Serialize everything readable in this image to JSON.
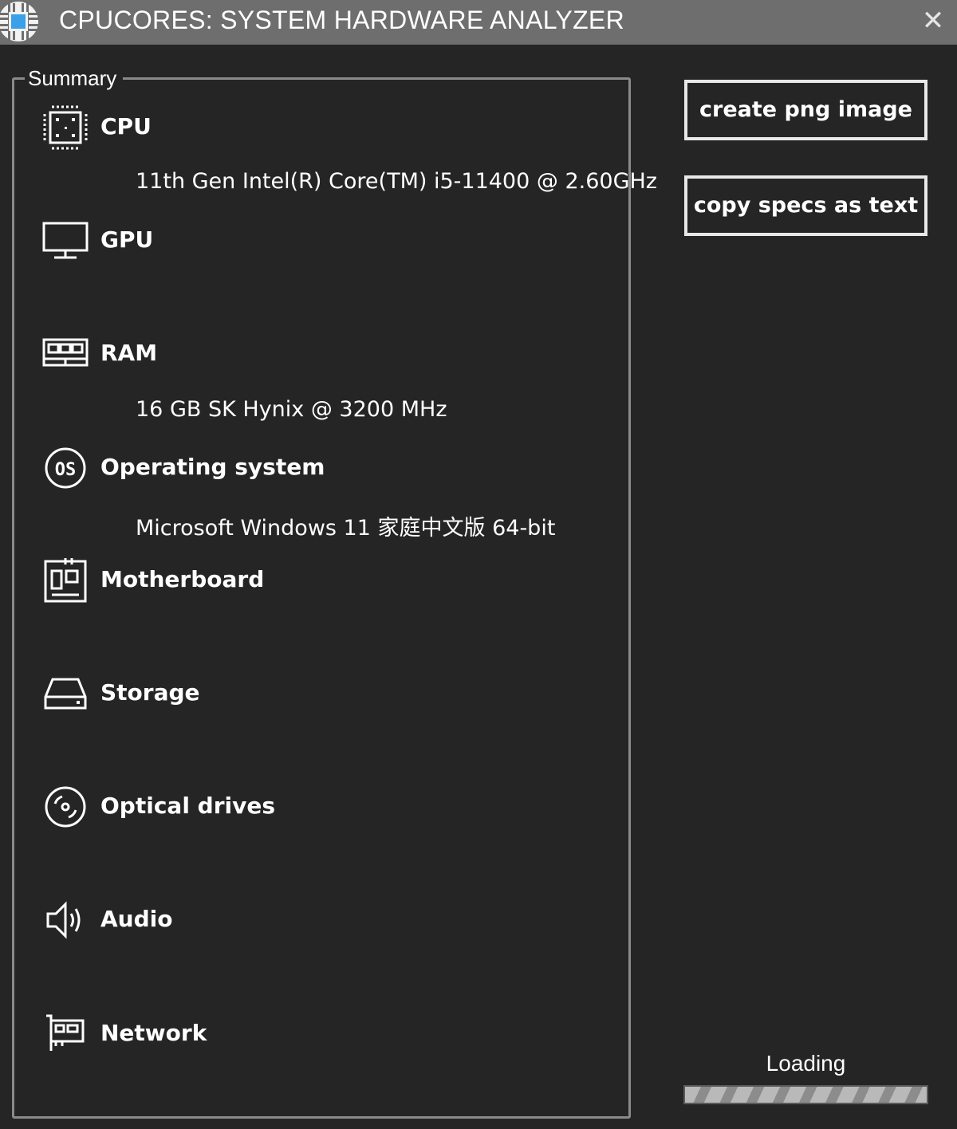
{
  "window": {
    "title": "CPUCORES: SYSTEM HARDWARE ANALYZER",
    "close_glyph": "✕",
    "accent": "#3aa0e8"
  },
  "summary": {
    "legend": "Summary",
    "sections": [
      {
        "label": "CPU",
        "value": "11th Gen Intel(R) Core(TM) i5-11400 @ 2.60GHz",
        "icon": "cpu-icon"
      },
      {
        "label": "GPU",
        "value": "",
        "icon": "monitor-icon"
      },
      {
        "label": "RAM",
        "value": "16 GB SK Hynix @ 3200 MHz",
        "icon": "ram-icon"
      },
      {
        "label": "Operating system",
        "value": "Microsoft Windows 11 家庭中文版 64-bit",
        "icon": "os-icon"
      },
      {
        "label": "Motherboard",
        "value": "",
        "icon": "motherboard-icon"
      },
      {
        "label": "Storage",
        "value": "",
        "icon": "hard-drive-icon"
      },
      {
        "label": "Optical drives",
        "value": "",
        "icon": "disc-icon"
      },
      {
        "label": "Audio",
        "value": "",
        "icon": "speaker-icon"
      },
      {
        "label": "Network",
        "value": "",
        "icon": "network-card-icon"
      }
    ]
  },
  "actions": {
    "create_png": "create png image",
    "copy_specs": "copy specs as text"
  },
  "status": {
    "loading_label": "Loading",
    "progress_fraction": 1.0
  }
}
